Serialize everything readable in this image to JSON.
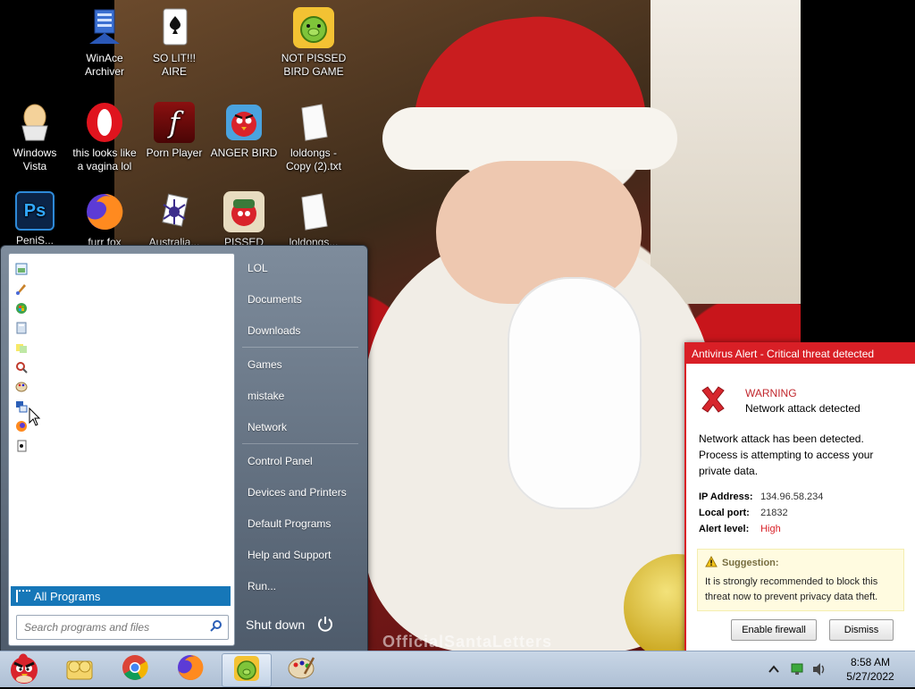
{
  "desktop": {
    "icons": [
      {
        "label": "WinAce Archiver",
        "icon": "winace-icon"
      },
      {
        "label": "SO LIT!!! AIRE",
        "icon": "solitaire-icon"
      },
      {
        "label": "NOT PISSED BIRD GAME",
        "icon": "bad-piggies-icon"
      },
      {
        "label": "Windows Vista",
        "icon": "egg-icon"
      },
      {
        "label": "this looks like a vagina lol",
        "icon": "opera-icon"
      },
      {
        "label": "Porn Player",
        "icon": "flash-icon"
      },
      {
        "label": "ANGER BIRD",
        "icon": "angry-bird-icon"
      },
      {
        "label": "loldongs - Copy (2).txt",
        "icon": "text-file-icon"
      },
      {
        "label": "PeniS...",
        "icon": "photoshop-icon"
      },
      {
        "label": "furr fox",
        "icon": "firefox-icon"
      },
      {
        "label": "Australia...",
        "icon": "spider-solitaire-icon"
      },
      {
        "label": "PISSED OFF...",
        "icon": "angry-birds-seasons-icon"
      },
      {
        "label": "loldongs...",
        "icon": "text-file-icon"
      }
    ],
    "wallpaper_watermark": "OfficialSantaLetters"
  },
  "start_menu": {
    "recent_programs": [
      "paint-icon",
      "brush-icon",
      "windows-orb-icon",
      "calculator-icon",
      "sticky-notes-icon",
      "magnifier-icon",
      "paint-palette-icon",
      "remote-desktop-icon",
      "firefox-icon",
      "solitaire-icon"
    ],
    "all_programs": "All Programs",
    "search_placeholder": "Search programs and files",
    "right_items": [
      "LOL",
      "Documents",
      "Downloads",
      "Games",
      "mistake",
      "Network",
      "Control Panel",
      "Devices and Printers",
      "Default Programs",
      "Help and Support",
      "Run..."
    ],
    "shutdown": "Shut down"
  },
  "alert": {
    "title": "Antivirus Alert - Critical threat detected",
    "warning": "WARNING",
    "subtitle": "Network attack detected",
    "description": "Network attack has been detected. Process is attempting to access your private data.",
    "ip_label": "IP Address:",
    "ip_value": "134.96.58.234",
    "port_label": "Local port:",
    "port_value": "21832",
    "level_label": "Alert level:",
    "level_value": "High",
    "suggestion_title": "Suggestion:",
    "suggestion_text": "It is strongly recommended to block this threat now to prevent privacy data theft.",
    "btn_firewall": "Enable firewall",
    "btn_dismiss": "Dismiss",
    "accent": "#d91f26"
  },
  "taskbar": {
    "apps": [
      "angry-bird-start-icon",
      "explorer-folder-icon",
      "chrome-icon",
      "firefox-icon",
      "bad-piggies-icon",
      "paint-palette-icon"
    ],
    "time": "8:58 AM",
    "date": "5/27/2022"
  }
}
